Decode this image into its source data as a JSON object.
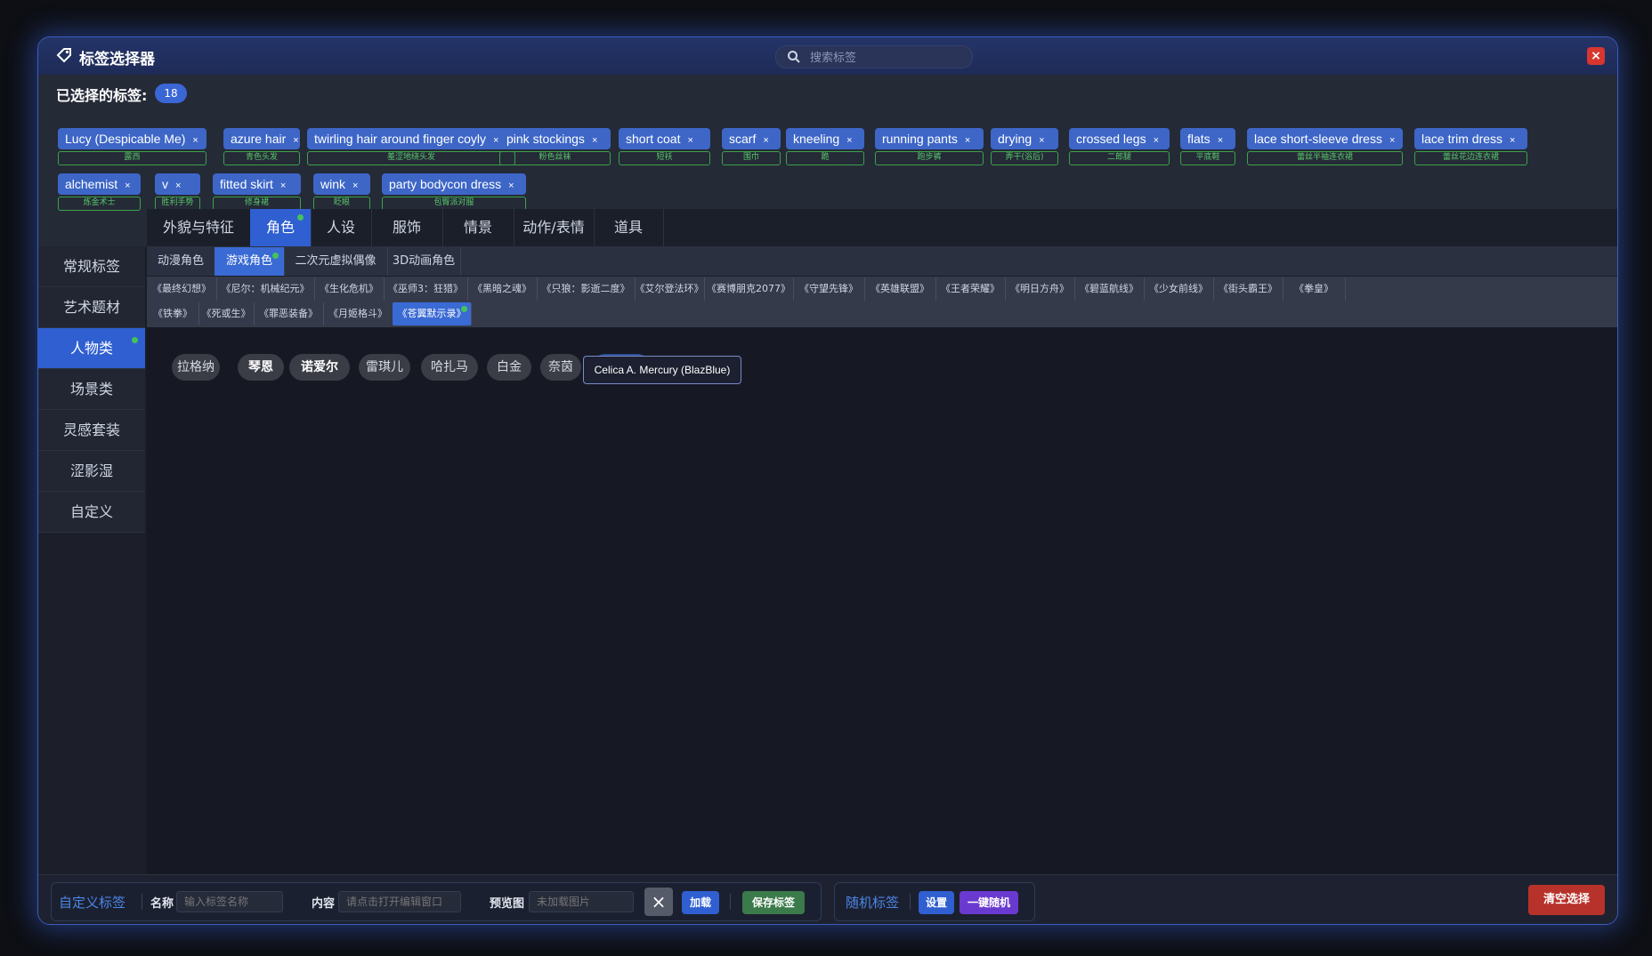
{
  "window": {
    "title": "标签选择器",
    "search_placeholder": "搜索标签",
    "close_label": "×"
  },
  "selected": {
    "label": "已选择的标签:",
    "count": "18",
    "tags": [
      {
        "name": "Lucy (Despicable Me)",
        "sub": "露西"
      },
      {
        "name": "azure hair",
        "sub": "青色头发"
      },
      {
        "name": "twirling hair around finger coyly",
        "sub": "羞涩地绕头发"
      },
      {
        "name": "pink stockings",
        "sub": "粉色丝袜"
      },
      {
        "name": "short coat",
        "sub": "短袄"
      },
      {
        "name": "scarf",
        "sub": "围巾"
      },
      {
        "name": "kneeling",
        "sub": "跪"
      },
      {
        "name": "running pants",
        "sub": "跑步裤"
      },
      {
        "name": "drying",
        "sub": "弄干(浴后)"
      },
      {
        "name": "crossed legs",
        "sub": "二郎腿"
      },
      {
        "name": "flats",
        "sub": "平底鞋"
      },
      {
        "name": "lace short-sleeve dress",
        "sub": "蕾丝半袖连衣裙"
      },
      {
        "name": "lace trim dress",
        "sub": "蕾丝花边连衣裙"
      },
      {
        "name": "alchemist",
        "sub": "炼金术士"
      },
      {
        "name": "v",
        "sub": "胜利手势"
      },
      {
        "name": "fitted skirt",
        "sub": "修身裙"
      },
      {
        "name": "wink",
        "sub": "眨眼"
      },
      {
        "name": "party bodycon dress",
        "sub": "包臀派对服"
      }
    ],
    "remove_glyph": "×"
  },
  "sidebar": {
    "items": [
      "常规标签",
      "艺术题材",
      "人物类",
      "场景类",
      "灵感套装",
      "涩影湿",
      "自定义"
    ],
    "active": "人物类"
  },
  "tabs_main": {
    "items": [
      "外貌与特征",
      "角色",
      "人设",
      "服饰",
      "情景",
      "动作/表情",
      "道具"
    ],
    "active": "角色"
  },
  "tabs_sub": {
    "items": [
      "动漫角色",
      "游戏角色",
      "二次元虚拟偶像",
      "3D动画角色"
    ],
    "active": "游戏角色"
  },
  "games": {
    "row1": [
      "《最终幻想》",
      "《尼尔：机械纪元》",
      "《生化危机》",
      "《巫师3：狂猎》",
      "《黑暗之魂》",
      "《只狼：影逝二度》",
      "《艾尔登法环》",
      "《赛博朋克2077》",
      "《守望先锋》",
      "《英雄联盟》",
      "《王者荣耀》",
      "《明日方舟》",
      "《碧蓝航线》",
      "《少女前线》",
      "《街头霸王》",
      "《拳皇》"
    ],
    "row2": [
      "《铁拳》",
      "《死或生》",
      "《罪恶装备》",
      "《月姬格斗》",
      "《苍翼默示录》"
    ],
    "active": "《苍翼默示录》"
  },
  "characters": {
    "items": [
      "拉格纳",
      "琴恩",
      "诺爱尔",
      "雷琪儿",
      "哈扎马",
      "白金",
      "奈茵",
      "赛利卡"
    ],
    "active": "赛利卡",
    "tooltip": "Celica A. Mercury (BlazBlue)"
  },
  "bottom": {
    "custom_label": "自定义标签",
    "name_label": "名称",
    "name_placeholder": "输入标签名称",
    "content_label": "内容",
    "content_placeholder": "请点击打开编辑窗口",
    "preview_label": "预览图",
    "preview_placeholder": "未加载图片",
    "clear_image_glyph": "×",
    "load_label": "加载",
    "save_label": "保存标签",
    "random_label": "随机标签",
    "settings_label": "设置",
    "one_click_random_label": "一键随机",
    "clear_selection_label": "清空选择"
  },
  "colors": {
    "accent": "#2f5fd0",
    "chip": "#3d66c7",
    "sub_green": "#3aa34a",
    "close_red": "#d8362f",
    "dot_green": "#43c35a",
    "save_green": "#3b7a4a",
    "purple": "#6a3ad0",
    "clear_red": "#b7322a"
  }
}
